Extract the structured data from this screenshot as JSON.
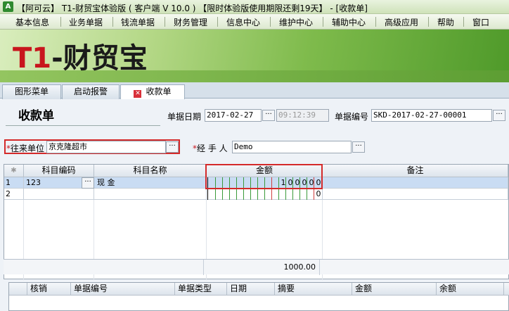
{
  "window": {
    "title": "【阿可云】 T1-财贸宝体验版 ( 客户端 V 10.0 ) 【限时体验版使用期限还剩19天】 - [收款单]"
  },
  "menu": [
    "基本信息",
    "业务单据",
    "钱流单据",
    "财务管理",
    "信息中心",
    "维护中心",
    "辅助中心",
    "高级应用",
    "帮助",
    "窗口"
  ],
  "banner": {
    "logo_prefix": "T1",
    "logo_suffix": "-财贸宝"
  },
  "tabs": [
    {
      "label": "图形菜单",
      "active": false
    },
    {
      "label": "启动报警",
      "active": false
    },
    {
      "label": "收款单",
      "active": true
    }
  ],
  "form": {
    "title": "收款单",
    "date_label": "单据日期",
    "date_value": "2017-02-27",
    "time_value": "09:12:39",
    "number_label": "单据编号",
    "number_value": "SKD-2017-02-27-00001",
    "partner_label": "往来单位",
    "partner_value": "京克隆超市",
    "handler_label": "经 手 人",
    "handler_value": "Demo",
    "dots": "···"
  },
  "grid": {
    "columns": [
      "科目编码",
      "科目名称",
      "金额",
      "备注"
    ],
    "rows": [
      {
        "num": "1",
        "code": "123",
        "name": "现    金",
        "amount_digits": [
          "1",
          "0",
          "0",
          "0",
          "0",
          "0"
        ],
        "remark": ""
      },
      {
        "num": "2",
        "code": "",
        "name": "",
        "amount_digits": [
          "0"
        ],
        "remark": ""
      }
    ],
    "total": "1000.00"
  },
  "grid2": {
    "columns": [
      "核销",
      "单据编号",
      "单据类型",
      "日期",
      "摘要",
      "金额",
      "余额"
    ]
  }
}
